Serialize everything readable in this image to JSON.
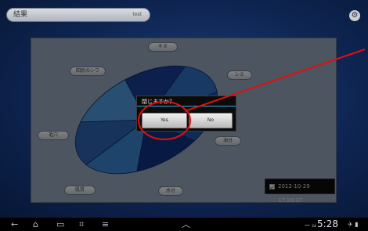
{
  "header": {
    "title": "結果",
    "subtitle": "test"
  },
  "chart_pills": [
    {
      "label": "キヌ"
    },
    {
      "label": "回民のシワ"
    },
    {
      "label": "シミ"
    },
    {
      "label": "毛穴"
    },
    {
      "label": "油分"
    },
    {
      "label": "肌質"
    },
    {
      "label": "水分"
    }
  ],
  "chart_data": {
    "type": "pie",
    "labels": [
      "キヌ",
      "シミ",
      "油分",
      "水分",
      "肌質",
      "毛穴",
      "回民のシワ"
    ],
    "values": [
      14,
      14,
      15,
      14,
      14,
      15,
      14
    ],
    "colors": [
      "#173a8c",
      "#2a69b6",
      "#1d4fa0",
      "#10307a",
      "#3a7cc4",
      "#2b5ea8",
      "#4a8fd0"
    ]
  },
  "dialog": {
    "message": "閉じますか？",
    "yes_label": "Yes",
    "no_label": "No"
  },
  "timestamp": {
    "checked": true,
    "text": "2012-10-29 17:28:37"
  },
  "navbar": {
    "clock": "5:28",
    "status_left": "一 ₂₄",
    "status_right": "✈ ▮"
  },
  "colors": {
    "annotation": "#e01010",
    "accent": "#33aadd"
  }
}
